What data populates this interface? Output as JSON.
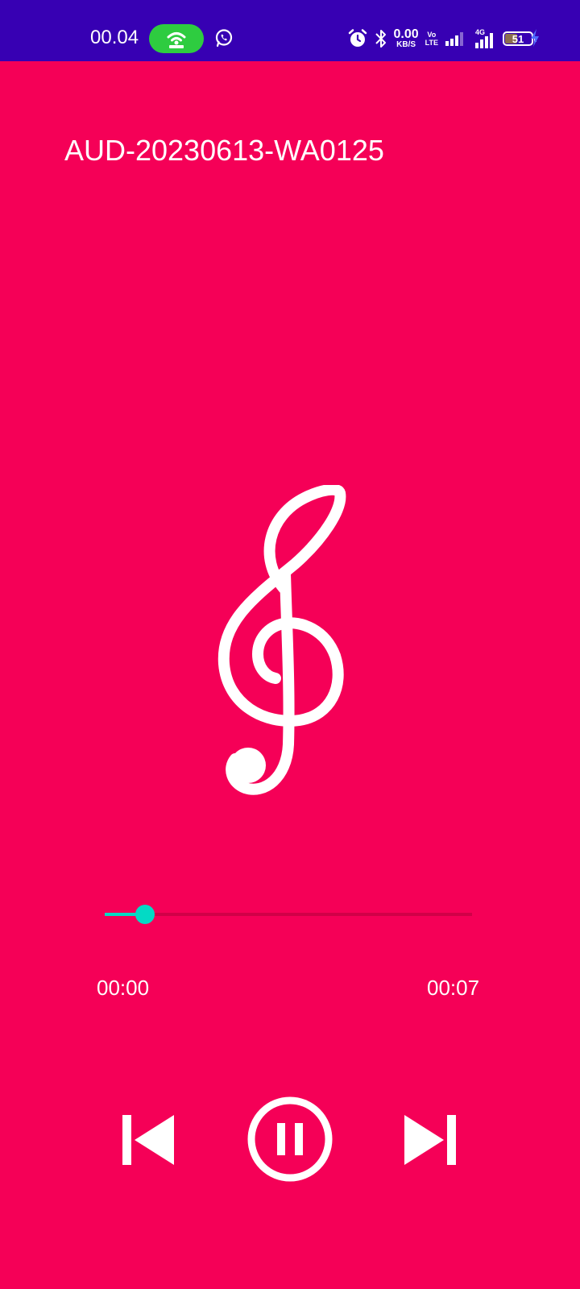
{
  "colors": {
    "status_bar_bg": "#3700B3",
    "background": "#F50057",
    "accent": "#03DAC5",
    "hotspot_pill": "#2ECC40",
    "seek_track": "#D10048",
    "icon": "#FFFFFF",
    "charging_bolt": "#4F6BFF"
  },
  "status_bar": {
    "time": "00.04",
    "net_speed_value": "0.00",
    "net_speed_unit": "KB/S",
    "volte_top": "Vo",
    "volte_bottom": "LTE",
    "network_type": "4G",
    "battery_level": "51",
    "battery_fraction": 0.51,
    "icons": [
      "hotspot-icon",
      "whatsapp-icon",
      "alarm-icon",
      "bluetooth-icon",
      "signal-icon",
      "signal-4g-icon",
      "battery-icon",
      "charging-icon"
    ]
  },
  "player": {
    "title": "AUD-20230613-WA0125",
    "album_art_icon": "treble-clef-icon",
    "progress_fraction": 0.11,
    "current_time": "00:00",
    "total_time": "00:07"
  },
  "controls": {
    "previous_icon": "skip-previous-icon",
    "pause_icon": "pause-circle-icon",
    "next_icon": "skip-next-icon"
  }
}
